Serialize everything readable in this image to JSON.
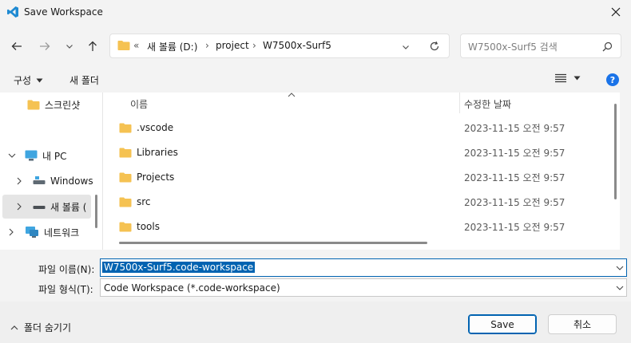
{
  "window": {
    "title": "Save Workspace"
  },
  "address": {
    "crumbs": [
      "새 볼륨 (D:)",
      "project",
      "W7500x-Surf5"
    ],
    "overflow": "«"
  },
  "search": {
    "placeholder": "W7500x-Surf5 검색"
  },
  "commandbar": {
    "organize": "구성",
    "new_folder": "새 폴더"
  },
  "nav": {
    "items": [
      {
        "label": "스크린샷",
        "icon": "folder-icon"
      },
      {
        "label": "내 PC",
        "icon": "pc-icon"
      },
      {
        "label": "Windows",
        "icon": "drive-icon"
      },
      {
        "label": "새 볼륨 (",
        "icon": "drive-icon"
      },
      {
        "label": "네트워크",
        "icon": "network-icon"
      }
    ]
  },
  "columns": {
    "name": "이름",
    "modified": "수정한 날짜"
  },
  "files": [
    {
      "name": ".vscode",
      "modified": "2023-11-15 오전 9:57"
    },
    {
      "name": "Libraries",
      "modified": "2023-11-15 오전 9:57"
    },
    {
      "name": "Projects",
      "modified": "2023-11-15 오전 9:57"
    },
    {
      "name": "src",
      "modified": "2023-11-15 오전 9:57"
    },
    {
      "name": "tools",
      "modified": "2023-11-15 오전 9:57"
    }
  ],
  "form": {
    "filename_label": "파일 이름(N):",
    "filename_value": "W7500x-Surf5.code-workspace",
    "filetype_label": "파일 형식(T):",
    "filetype_value": "Code Workspace (*.code-workspace)"
  },
  "footer": {
    "hide_folders": "폴더 숨기기",
    "save": "Save",
    "cancel": "취소"
  },
  "colors": {
    "accent": "#0063b1",
    "folder": "#f5c252",
    "help": "#1a73e8"
  }
}
